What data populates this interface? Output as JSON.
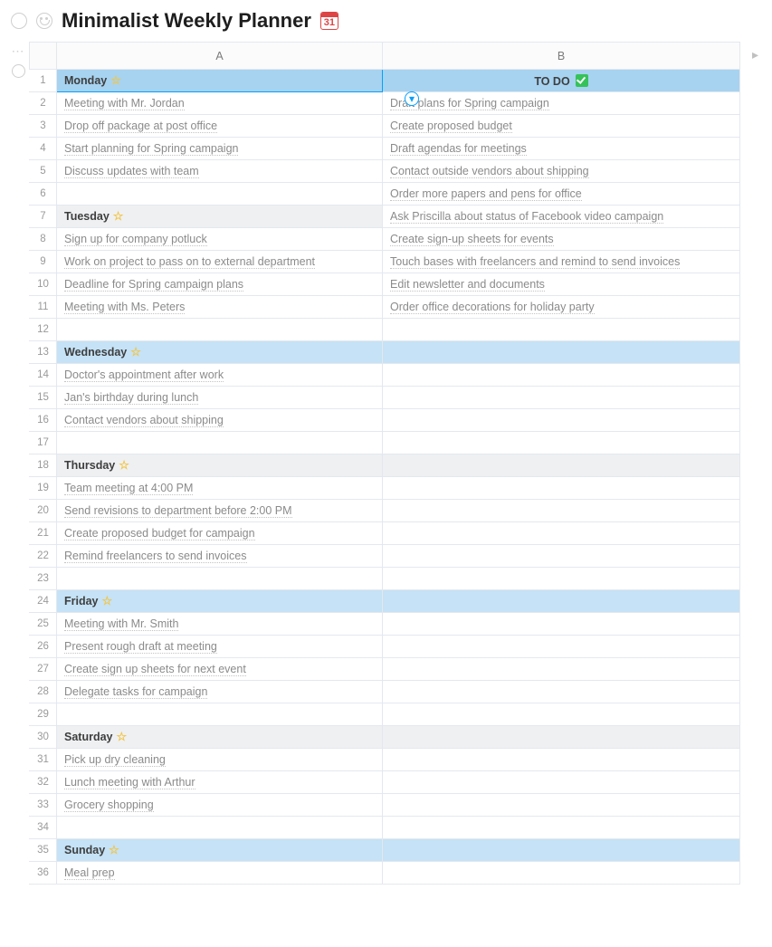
{
  "header": {
    "title": "Minimalist Weekly Planner",
    "cal_day": "31"
  },
  "columns": [
    "A",
    "B"
  ],
  "rows": [
    {
      "n": 1,
      "style": "sel",
      "a": "Monday",
      "a_icon": "star",
      "b": "TO DO",
      "b_icon": "check",
      "b_center": true
    },
    {
      "n": 2,
      "style": "link",
      "a": "Meeting with Mr. Jordan",
      "b": "Draft plans for Spring campaign"
    },
    {
      "n": 3,
      "style": "link",
      "a": "Drop off package at post office",
      "b": "Create proposed budget"
    },
    {
      "n": 4,
      "style": "link",
      "a": "Start planning for Spring campaign",
      "b": "Draft agendas for meetings"
    },
    {
      "n": 5,
      "style": "link",
      "a": "Discuss updates with team",
      "b": "Contact outside vendors about shipping"
    },
    {
      "n": 6,
      "style": "link",
      "a": "",
      "b": "Order more papers and pens for office"
    },
    {
      "n": 7,
      "style": "grey",
      "a": "Tuesday",
      "a_icon": "star",
      "b": "Ask Priscilla about status of Facebook video campaign",
      "b_link": true
    },
    {
      "n": 8,
      "style": "link",
      "a": "Sign up for company potluck",
      "b": "Create sign-up sheets for events"
    },
    {
      "n": 9,
      "style": "link",
      "a": "Work on project to pass on to external department",
      "b": "Touch bases with freelancers and remind to send invoices"
    },
    {
      "n": 10,
      "style": "link",
      "a": "Deadline for Spring campaign plans",
      "b": "Edit newsletter and documents"
    },
    {
      "n": 11,
      "style": "link",
      "a": "Meeting with Ms. Peters",
      "b": "Order office decorations for holiday party"
    },
    {
      "n": 12,
      "style": "",
      "a": "",
      "b": ""
    },
    {
      "n": 13,
      "style": "blue",
      "a": "Wednesday",
      "a_icon": "star",
      "b": ""
    },
    {
      "n": 14,
      "style": "link",
      "a": "Doctor's appointment after work",
      "b": ""
    },
    {
      "n": 15,
      "style": "link",
      "a": "Jan's birthday during lunch",
      "b": ""
    },
    {
      "n": 16,
      "style": "link",
      "a": "Contact vendors about shipping",
      "b": ""
    },
    {
      "n": 17,
      "style": "",
      "a": "",
      "b": ""
    },
    {
      "n": 18,
      "style": "grey",
      "a": "Thursday",
      "a_icon": "star",
      "b": ""
    },
    {
      "n": 19,
      "style": "link",
      "a": "Team meeting at 4:00 PM",
      "b": ""
    },
    {
      "n": 20,
      "style": "link",
      "a": "Send revisions to department before 2:00 PM",
      "b": ""
    },
    {
      "n": 21,
      "style": "link",
      "a": "Create proposed budget for campaign",
      "b": ""
    },
    {
      "n": 22,
      "style": "link",
      "a": "Remind freelancers to send invoices",
      "b": ""
    },
    {
      "n": 23,
      "style": "",
      "a": "",
      "b": ""
    },
    {
      "n": 24,
      "style": "blue",
      "a": "Friday",
      "a_icon": "star",
      "b": ""
    },
    {
      "n": 25,
      "style": "link",
      "a": "Meeting with Mr. Smith",
      "b": ""
    },
    {
      "n": 26,
      "style": "link",
      "a": "Present rough draft at meeting",
      "b": ""
    },
    {
      "n": 27,
      "style": "link",
      "a": "Create sign up sheets for next event",
      "b": ""
    },
    {
      "n": 28,
      "style": "link",
      "a": "Delegate tasks for campaign",
      "b": ""
    },
    {
      "n": 29,
      "style": "",
      "a": "",
      "b": ""
    },
    {
      "n": 30,
      "style": "grey",
      "a": "Saturday",
      "a_icon": "star",
      "b": ""
    },
    {
      "n": 31,
      "style": "link",
      "a": "Pick up dry cleaning",
      "b": ""
    },
    {
      "n": 32,
      "style": "link",
      "a": "Lunch meeting with Arthur",
      "b": ""
    },
    {
      "n": 33,
      "style": "link",
      "a": "Grocery shopping",
      "b": ""
    },
    {
      "n": 34,
      "style": "",
      "a": "",
      "b": ""
    },
    {
      "n": 35,
      "style": "blue",
      "a": "Sunday",
      "a_icon": "star",
      "b": ""
    },
    {
      "n": 36,
      "style": "link",
      "a": "Meal prep",
      "b": ""
    }
  ]
}
